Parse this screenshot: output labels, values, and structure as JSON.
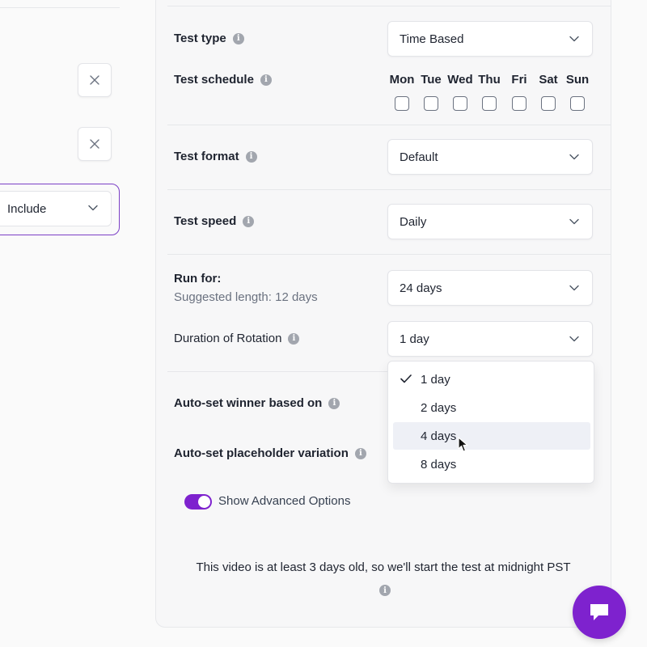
{
  "left_panel": {
    "include_select_value": "Include",
    "remove_icon": "x-icon",
    "chevron_icon": "chevron-down-icon"
  },
  "settings": {
    "test_type": {
      "label": "Test type",
      "value": "Time Based"
    },
    "test_schedule": {
      "label": "Test schedule",
      "days": [
        "Mon",
        "Tue",
        "Wed",
        "Thu",
        "Fri",
        "Sat",
        "Sun"
      ]
    },
    "test_format": {
      "label": "Test format",
      "value": "Default"
    },
    "test_speed": {
      "label": "Test speed",
      "value": "Daily"
    },
    "run_for": {
      "label": "Run for:",
      "sublabel": "Suggested length: 12 days",
      "value": "24 days"
    },
    "duration_of_rotation": {
      "label": "Duration of Rotation",
      "value": "1 day",
      "options": [
        "1 day",
        "2 days",
        "4 days",
        "8 days"
      ],
      "selected_option": "1 day",
      "hovered_option": "4 days"
    },
    "auto_set_winner": {
      "label": "Auto-set winner based on"
    },
    "auto_set_placeholder": {
      "label": "Auto-set placeholder variation"
    },
    "advanced_options": {
      "label": "Show Advanced Options",
      "enabled": true
    }
  },
  "notice": "This video is at least 3 days old, so we'll start the test at midnight PST",
  "colors": {
    "accent": "#7e22ce",
    "include_border": "#7b3fc6",
    "hover": "#eef0f6"
  },
  "icons": {
    "info": "info-icon",
    "check": "check-icon",
    "chat": "chat-icon",
    "cursor": "mouse-pointer-icon"
  }
}
